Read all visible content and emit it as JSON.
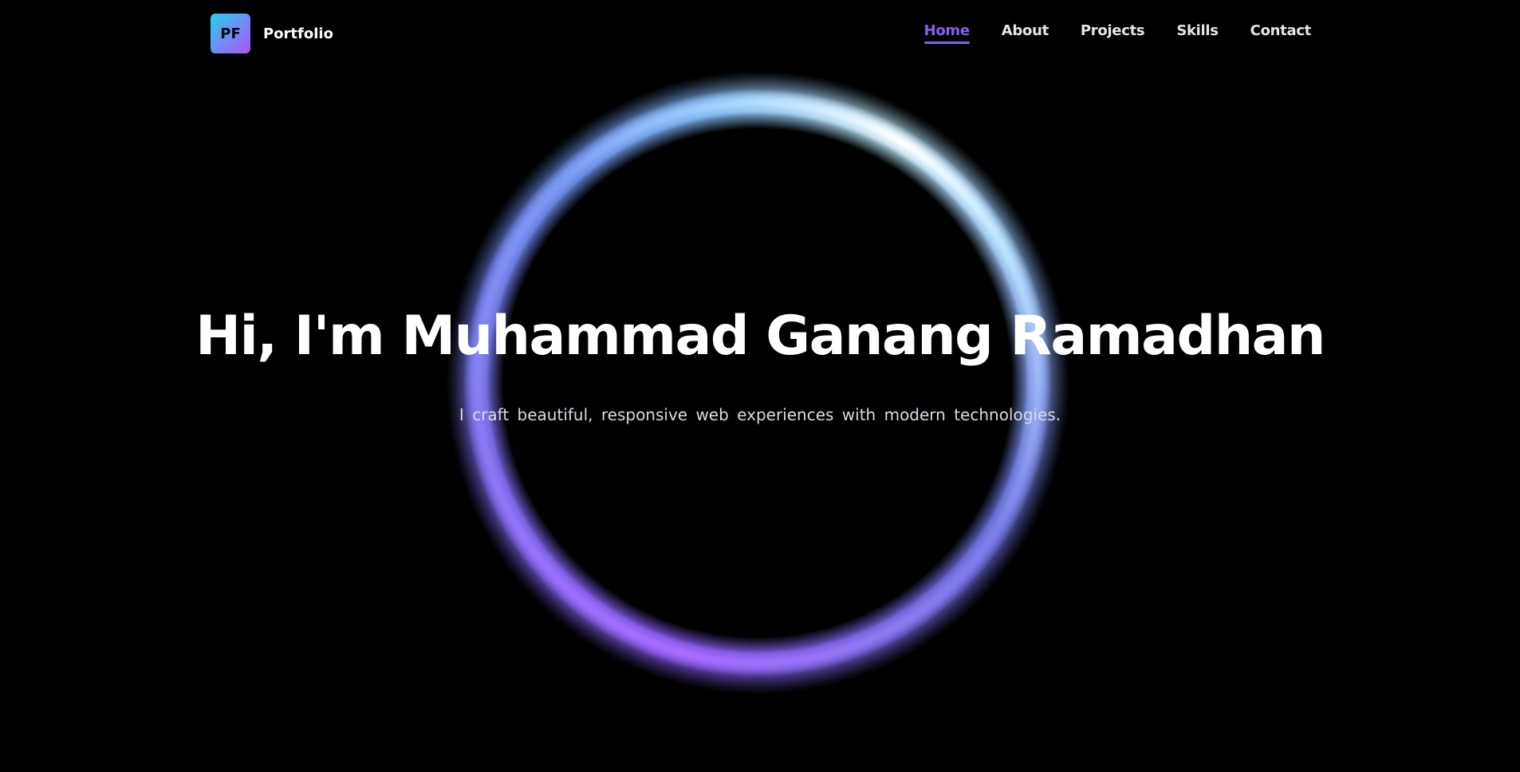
{
  "brand": {
    "logo_text": "PF",
    "name": "Portfolio"
  },
  "nav": {
    "items": [
      {
        "label": "Home",
        "active": true
      },
      {
        "label": "About",
        "active": false
      },
      {
        "label": "Projects",
        "active": false
      },
      {
        "label": "Skills",
        "active": false
      },
      {
        "label": "Contact",
        "active": false
      }
    ]
  },
  "hero": {
    "title": "Hi, I'm Muhammad Ganang Ramadhan",
    "subtitle": "I craft beautiful, responsive web experiences with modern technologies."
  },
  "colors": {
    "background": "#000000",
    "accent": "#8b5cf6",
    "ring_purple": "#8b5cf6",
    "ring_cyan": "#c6f3ff"
  }
}
